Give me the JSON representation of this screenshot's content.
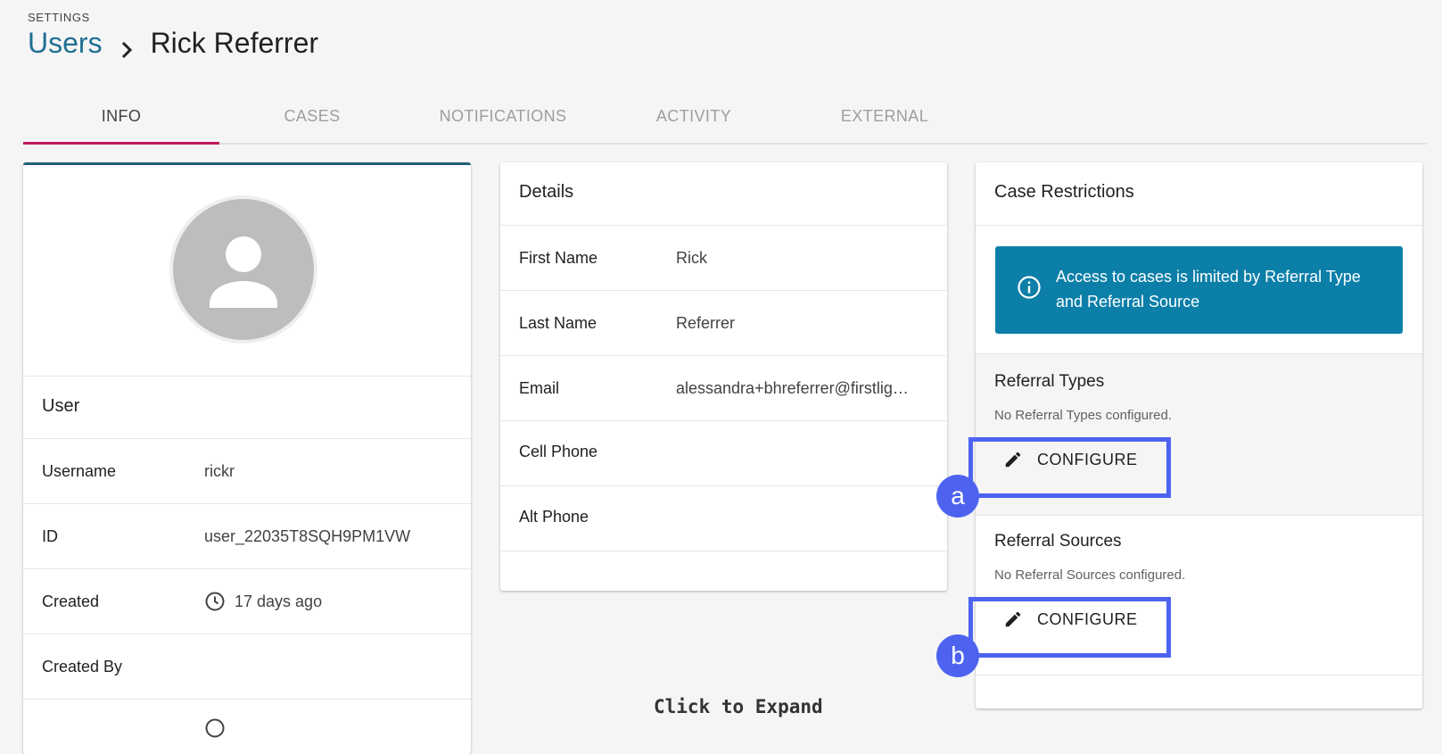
{
  "header": {
    "section_label": "SETTINGS",
    "breadcrumb_link": "Users",
    "current_page": "Rick Referrer"
  },
  "tabs": [
    {
      "label": "INFO",
      "active": true
    },
    {
      "label": "CASES",
      "active": false
    },
    {
      "label": "NOTIFICATIONS",
      "active": false
    },
    {
      "label": "ACTIVITY",
      "active": false
    },
    {
      "label": "EXTERNAL",
      "active": false
    }
  ],
  "user_card": {
    "avatar_icon": "person-icon",
    "section_title": "User",
    "fields": [
      {
        "label": "Username",
        "value": "rickr"
      },
      {
        "label": "ID",
        "value": "user_22035T8SQH9PM1VW"
      },
      {
        "label": "Created",
        "value": "17 days ago",
        "icon": "clock-icon"
      },
      {
        "label": "Created By",
        "value": ""
      }
    ]
  },
  "details_card": {
    "title": "Details",
    "fields": [
      {
        "label": "First Name",
        "value": "Rick"
      },
      {
        "label": "Last Name",
        "value": "Referrer"
      },
      {
        "label": "Email",
        "value": "alessandra+bhreferrer@firstlig…"
      },
      {
        "label": "Cell Phone",
        "value": ""
      },
      {
        "label": "Alt Phone",
        "value": ""
      }
    ]
  },
  "restrictions_card": {
    "title": "Case Restrictions",
    "info_icon": "info-icon",
    "info_text": "Access to cases is limited by Referral Type and Referral Source",
    "referral_types": {
      "title": "Referral Types",
      "note": "No Referral Types configured.",
      "button": "CONFIGURE",
      "callout": "a"
    },
    "referral_sources": {
      "title": "Referral Sources",
      "note": "No Referral Sources configured.",
      "button": "CONFIGURE",
      "callout": "b"
    }
  },
  "overlay": {
    "expand_label": "Click to Expand"
  },
  "colors": {
    "accent_link": "#1f6f93",
    "tab_indicator": "#c2185b",
    "info_banner": "#0c7fa8",
    "callout": "#4d63f0"
  }
}
